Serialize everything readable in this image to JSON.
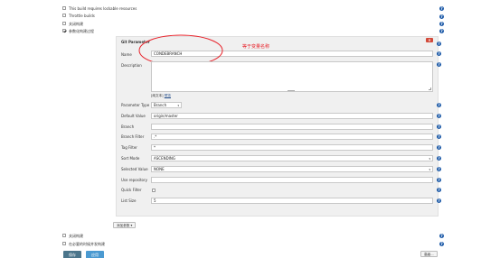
{
  "options": [
    {
      "label": "This build requires lockable resources",
      "checked": false
    },
    {
      "label": "Throttle builds",
      "checked": false
    },
    {
      "label": "关闭构建",
      "checked": false
    },
    {
      "label": "参数化构建过程",
      "checked": true
    }
  ],
  "param": {
    "title": "Git Parameter",
    "name_label": "Name",
    "name_value": "CONDEBRANCH",
    "annotation": "等于变量名称",
    "description_label": "Description",
    "preview_text": "[纯文本]",
    "preview_link": "预览",
    "fields": [
      {
        "key": "type",
        "label": "Parameter Type",
        "value": "Branch",
        "kind": "select"
      },
      {
        "key": "default",
        "label": "Default Value",
        "value": "origin/master",
        "kind": "input"
      },
      {
        "key": "branch",
        "label": "Branch",
        "value": "",
        "kind": "input"
      },
      {
        "key": "branch_filter",
        "label": "Branch Filter",
        "value": ".*",
        "kind": "input"
      },
      {
        "key": "tag_filter",
        "label": "Tag Filter",
        "value": "*",
        "kind": "input"
      },
      {
        "key": "sort_mode",
        "label": "Sort Mode",
        "value": "ASCENDING",
        "kind": "select"
      },
      {
        "key": "selected_value",
        "label": "Selected Value",
        "value": "NONE",
        "kind": "select"
      },
      {
        "key": "use_repository",
        "label": "Use repository",
        "value": "",
        "kind": "input"
      },
      {
        "key": "quick_filter",
        "label": "Quick Filter",
        "value": "",
        "kind": "checkbox"
      },
      {
        "key": "list_size",
        "label": "List Size",
        "value": "5",
        "kind": "input"
      }
    ],
    "add_param_label": "添加参数"
  },
  "bottom_options": [
    {
      "label": "关闭构建",
      "checked": false
    },
    {
      "label": "在必要的时候并发构建",
      "checked": false
    }
  ],
  "advanced_label": "高级...",
  "buttons": {
    "save": "保存",
    "apply": "应用"
  },
  "colors": {
    "help": "#1e5ba8",
    "annotation": "#e8232b",
    "save": "#4b758b",
    "apply": "#4b9ad1"
  },
  "icons": {
    "help": "help-icon",
    "delete": "delete-icon"
  }
}
